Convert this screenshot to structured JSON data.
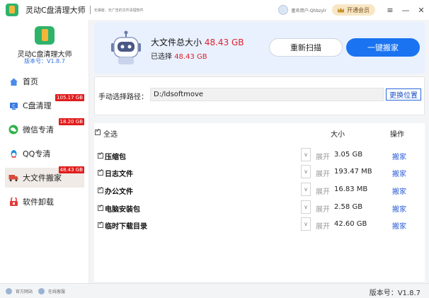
{
  "titlebar": {
    "title": "灵动C盘清理大师",
    "subtitle": "无弹窗、无广告的文件清理软件",
    "user": "匿名用户-Qhbzylr",
    "vip_label": "开通会员"
  },
  "sidebar": {
    "app_name": "灵动C盘清理大师",
    "version": "版本号：V1.8.7",
    "items": [
      {
        "label": "首页",
        "icon": "home-icon",
        "badge": ""
      },
      {
        "label": "C盘清理",
        "icon": "drive-c-icon",
        "badge": "105.17 GB"
      },
      {
        "label": "微信专清",
        "icon": "wechat-icon",
        "badge": "18.20 GB"
      },
      {
        "label": "QQ专清",
        "icon": "qq-icon",
        "badge": ""
      },
      {
        "label": "大文件搬家",
        "icon": "truck-icon",
        "badge": "48.43 GB"
      },
      {
        "label": "软件卸载",
        "icon": "uninstall-icon",
        "badge": ""
      }
    ]
  },
  "summary": {
    "total_label": "大文件总大小",
    "total_size": "48.43 GB",
    "selected_label": "已选择",
    "selected_size": "48.43 GB",
    "rescan_label": "重新扫描",
    "move_all_label": "一键搬家"
  },
  "path": {
    "label": "手动选择路径：",
    "value": "D:/ldsoftmove",
    "change_label": "更换位置"
  },
  "table": {
    "select_all": "全选",
    "col_size": "大小",
    "col_action": "操作",
    "rows": [
      {
        "name": "压缩包",
        "expand": "展开",
        "size": "3.05 GB",
        "action": "搬家"
      },
      {
        "name": "日志文件",
        "expand": "展开",
        "size": "193.47 MB",
        "action": "搬家"
      },
      {
        "name": "办公文件",
        "expand": "展开",
        "size": "16.83 MB",
        "action": "搬家"
      },
      {
        "name": "电脑安装包",
        "expand": "展开",
        "size": "2.58 GB",
        "action": "搬家"
      },
      {
        "name": "临时下载目录",
        "expand": "展开",
        "size": "42.60 GB",
        "action": "搬家"
      }
    ]
  },
  "footer": {
    "website": "官方网站",
    "service": "在线客服",
    "version": "版本号：V1.8.7"
  },
  "colors": {
    "accent": "#1a73f0",
    "badge": "#e01d1d",
    "size_highlight": "#e0202a",
    "summary_bg": "#e9f1ff"
  }
}
